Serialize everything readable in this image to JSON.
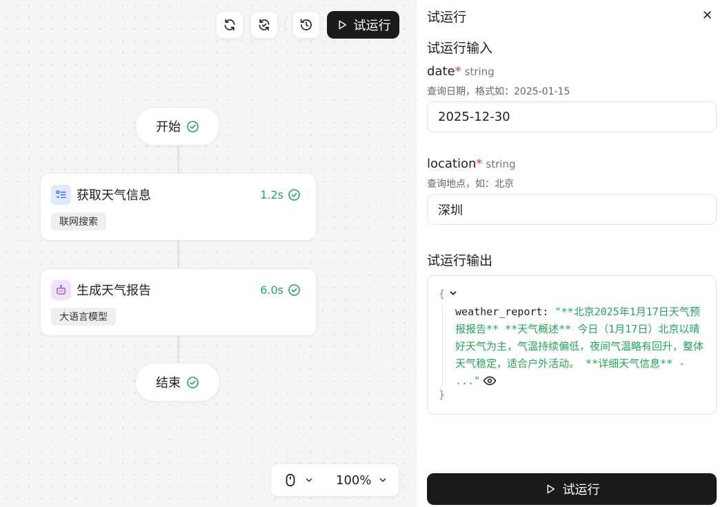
{
  "toolbar": {
    "refresh_icon": "refresh-icon",
    "sync_icon": "sync-icon",
    "history_icon": "history-icon",
    "run_label": "试运行"
  },
  "nodes": {
    "start": {
      "label": "开始",
      "status": "success"
    },
    "fetch": {
      "title": "获取天气信息",
      "time": "1.2s",
      "tag": "联网搜索",
      "icon": "checklist-icon"
    },
    "generate": {
      "title": "生成天气报告",
      "time": "6.0s",
      "tag": "大语言模型",
      "icon": "robot-icon"
    },
    "end": {
      "label": "结束",
      "status": "success"
    }
  },
  "zoom": {
    "mode_icon": "mouse-icon",
    "level": "100%"
  },
  "panel": {
    "title": "试运行",
    "input_section": "试运行输入",
    "fields": [
      {
        "name": "date",
        "type": "string",
        "required": "*",
        "desc": "查询日期，格式如：2025-01-15",
        "value": "2025-12-30"
      },
      {
        "name": "location",
        "type": "string",
        "required": "*",
        "desc": "查询地点，如：北京",
        "value": "深圳"
      }
    ],
    "output_section": "试运行输出",
    "output": {
      "open_brace": "{",
      "close_brace": "}",
      "key": "weather_report:",
      "value": "\"**北京2025年1月17日天气预报报告** **天气概述** 今日（1月17日）北京以晴好天气为主，气温持续偏低，夜间气温略有回升，整体天气稳定，适合户外活动。 **详细天气信息** - ...\""
    },
    "run_label": "试运行"
  },
  "colors": {
    "success": "#22a65a",
    "dark": "#1a1a1a",
    "required": "#d83a3a"
  }
}
